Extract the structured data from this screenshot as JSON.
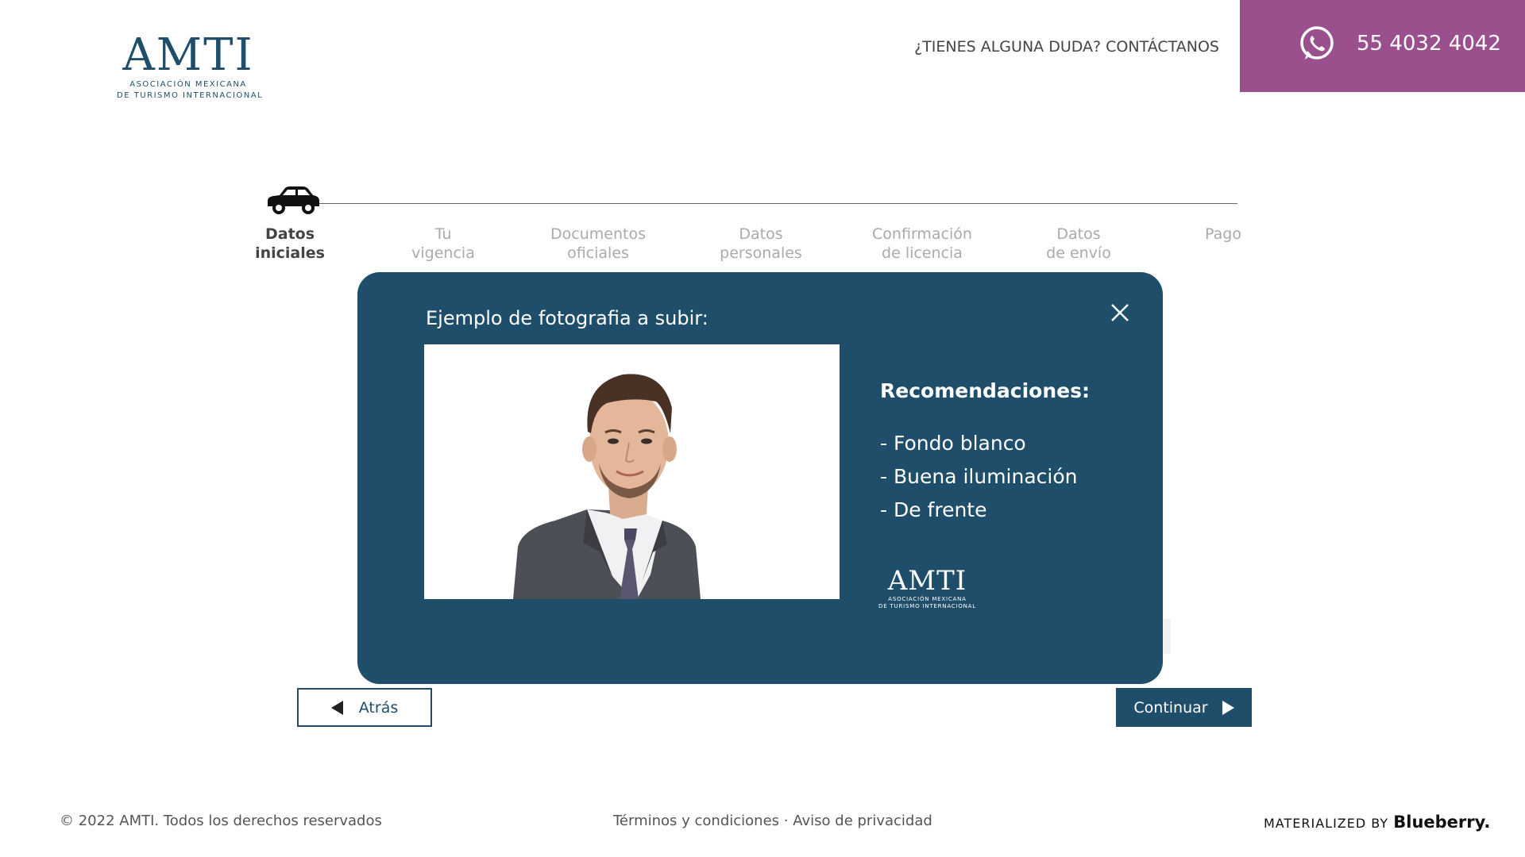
{
  "header": {
    "logo_main": "AMTI",
    "logo_line1": "ASOCIACIÓN MEXICANA",
    "logo_line2": "DE TURISMO INTERNACIONAL",
    "contact_text": "¿TIENES ALGUNA DUDA? CONTÁCTANOS",
    "phone": "55 4032 4042",
    "whatsapp_icon": "whatsapp-icon",
    "accent_color": "#9b508e"
  },
  "stepper": {
    "icon": "car-icon",
    "steps": [
      {
        "line1": "Datos",
        "line2": "iniciales"
      },
      {
        "line1": "Tu",
        "line2": "vigencia"
      },
      {
        "line1": "Documentos",
        "line2": "oficiales"
      },
      {
        "line1": "Datos",
        "line2": "personales"
      },
      {
        "line1": "Confirmación",
        "line2": "de licencia"
      },
      {
        "line1": "Datos",
        "line2": "de envío"
      },
      {
        "line1": "Pago",
        "line2": ""
      }
    ],
    "active_index": 0
  },
  "modal": {
    "title": "Ejemplo de fotografia a subir:",
    "close_icon": "close-icon",
    "recommendations_title": "Recomendaciones:",
    "recommendations": [
      "- Fondo blanco",
      "- Buena iluminación",
      "- De frente"
    ],
    "background_color": "#1f4e6b",
    "logo_main": "AMTI",
    "logo_line1": "ASOCIACIÓN MEXICANA",
    "logo_line2": "DE TURISMO INTERNACIONAL"
  },
  "nav": {
    "back_label": "Atrás",
    "next_label": "Continuar"
  },
  "footer": {
    "copyright": "© 2022 AMTI. Todos los derechos reservados",
    "terms": "Términos y condiciones",
    "separator": "·",
    "privacy": "Aviso de privacidad",
    "materialized": "MATERIALIZED BY",
    "brand": "Blueberry."
  }
}
